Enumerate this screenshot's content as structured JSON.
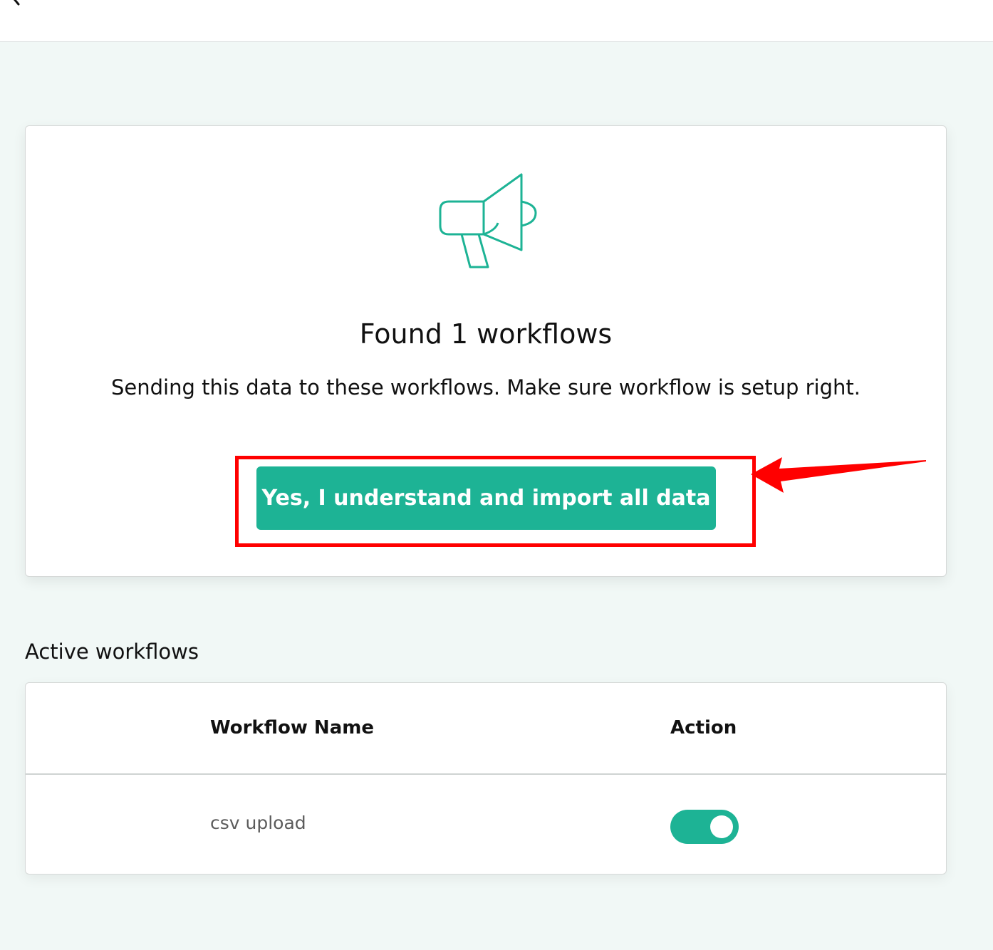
{
  "card": {
    "icon": "megaphone-icon",
    "title": "Found 1 workflows",
    "subtitle": "Sending this data to these workflows. Make sure workflow is setup right.",
    "import_button": "Yes, I understand and import all data"
  },
  "active_workflows": {
    "title": "Active workflows",
    "columns": [
      "Workflow Name",
      "Action"
    ],
    "rows": [
      {
        "name": "csv upload",
        "enabled": true
      }
    ]
  },
  "colors": {
    "accent": "#1db395",
    "annotation": "#ff0000",
    "background": "#f1f8f6"
  }
}
